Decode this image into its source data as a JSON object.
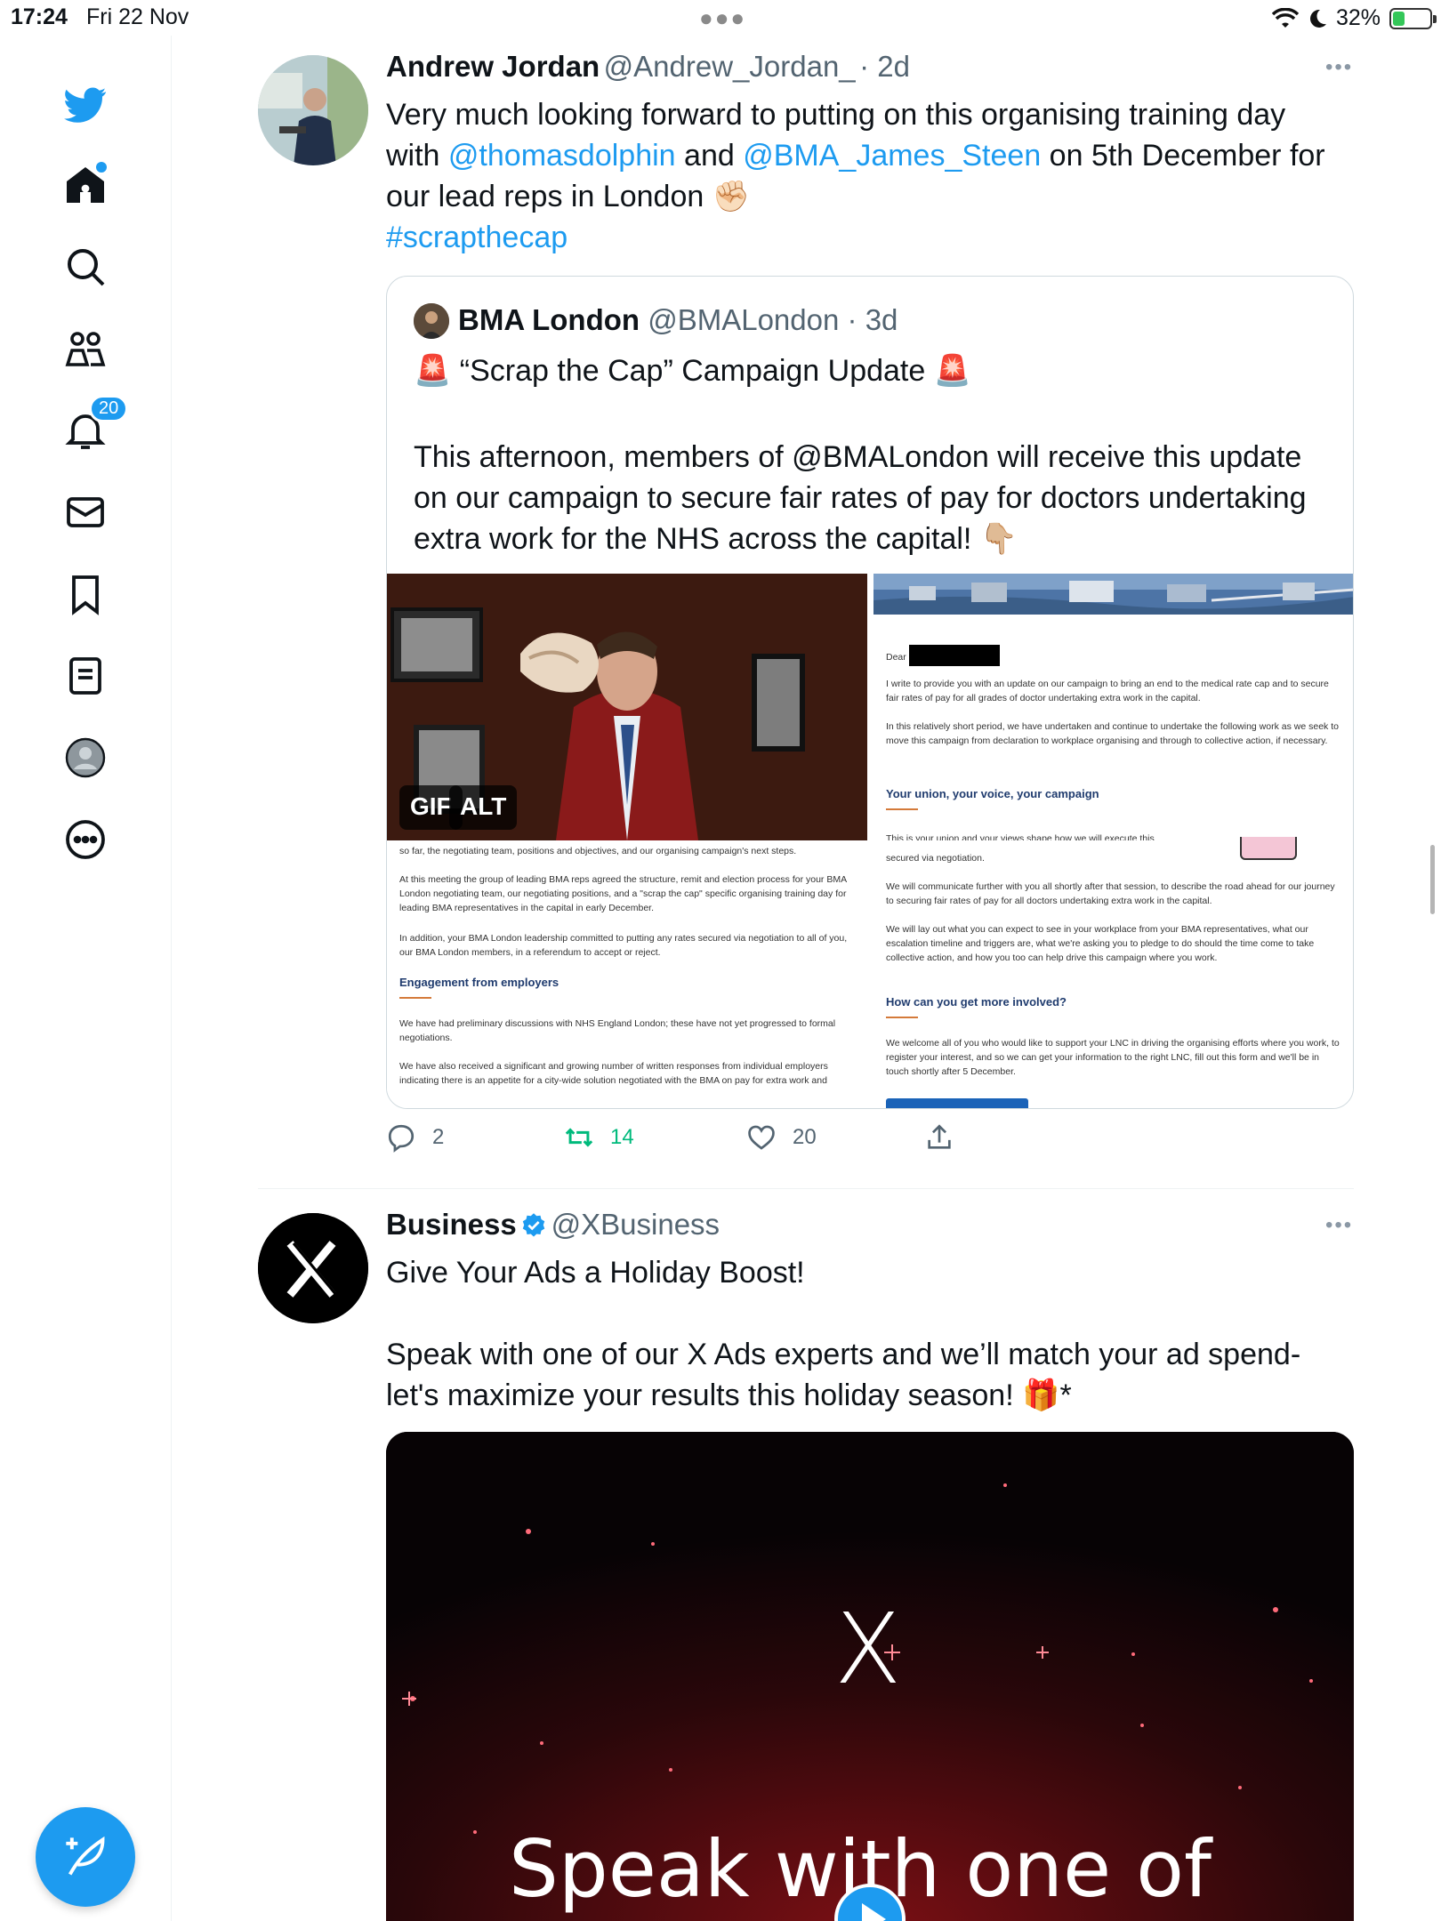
{
  "status_bar": {
    "time": "17:24",
    "date": "Fri 22 Nov",
    "battery": "32%",
    "battery_level": 0.32
  },
  "sidebar": {
    "items": [
      {
        "label": "logo"
      },
      {
        "label": "home"
      },
      {
        "label": "explore"
      },
      {
        "label": "communities"
      },
      {
        "label": "notifications",
        "badge": "20"
      },
      {
        "label": "messages"
      },
      {
        "label": "bookmarks"
      },
      {
        "label": "lists"
      },
      {
        "label": "profile"
      },
      {
        "label": "more"
      }
    ]
  },
  "tweet1": {
    "name": "Andrew Jordan",
    "handle": "@Andrew_Jordan_",
    "time": "· 2d",
    "text_line1": "Very much looking forward to putting on this organising training day",
    "text_with": "with ",
    "mention1": "@thomasdolphin",
    "text_and": " and ",
    "mention2": "@BMA_James_Steen",
    "text_on": " on 5th December for",
    "text_line3": "our lead reps in London ✊🏻",
    "hashtag": "#scrapthecap",
    "quote": {
      "name": "BMA London",
      "handle": "@BMALondon",
      "time": "· 3d",
      "title": "🚨 “Scrap the Cap” Campaign Update 🚨",
      "body": "This afternoon, members of @BMALondon will receive this update on our campaign to secure fair rates of pay for doctors undertaking extra work for the NHS across the capital! 👇🏼",
      "gif_label": "GIF",
      "alt_label": "ALT",
      "left_doc": {
        "p1": "so far, the negotiating team, positions and objectives, and our organising campaign's next steps.",
        "p2": "At this meeting the group of leading BMA reps agreed the structure, remit and election process for your BMA London negotiating team, our negotiating positions, and a \"scrap the cap\" specific organising training day for leading BMA representatives in the capital in early December.",
        "p3": "In addition, your BMA London leadership committed to putting any rates secured via negotiation to all of you, our BMA London members, in a referendum to accept or reject.",
        "h1": "Engagement from employers",
        "p4": "We have had preliminary discussions with NHS England London; these have not yet progressed to formal negotiations.",
        "p5": "We have also received a significant and growing number of written responses from individual employers indicating there is an appetite for a city-wide solution negotiated with the BMA on pay for extra work and"
      },
      "right_doc": {
        "dear": "Dear",
        "p1": "I write to provide you with an update on our campaign to bring an end to the medical rate cap and to secure fair rates of pay for all grades of doctor undertaking extra work in the capital.",
        "p2": "In this relatively short period, we have undertaken and continue to undertake the following work as we seek to move this campaign from declaration to workplace organising and through to collective action, if necessary.",
        "h1": "Your union, your voice, your campaign",
        "p3": "This is your union and your views shape how we will execute this",
        "p4": "secured via negotiation.",
        "p5": "We will communicate further with you all shortly after that session, to describe the road ahead for our journey to securing fair rates of pay for all doctors undertaking extra work in the capital.",
        "p6": "We will lay out what you can expect to see in your workplace from your BMA representatives, what our escalation timeline and triggers are, what we're asking you to pledge to do should the time come to take collective action, and how you too can help drive this campaign where you work.",
        "h2": "How can you get more involved?",
        "p7": "We welcome all of you who would like to support your LNC in driving the organising efforts where you work, to register your interest, and so we can get your information to the right LNC, fill out this form and we'll be in touch shortly after 5 December."
      }
    },
    "actions": {
      "replies": "2",
      "retweets": "14",
      "likes": "20"
    }
  },
  "tweet2": {
    "name": "Business",
    "handle": "@XBusiness",
    "line1": "Give Your Ads a Holiday Boost!",
    "line2": "Speak with one of our X Ads experts and we’ll match your ad spend-",
    "line3": "let's maximize your results this holiday season! 🎁*",
    "promo_logo": "X",
    "promo_text": "Speak with one of"
  },
  "colors": {
    "accent": "#1d9bf0",
    "retweet": "#00ba7c",
    "text": "#0f1419",
    "muted": "#536471"
  }
}
